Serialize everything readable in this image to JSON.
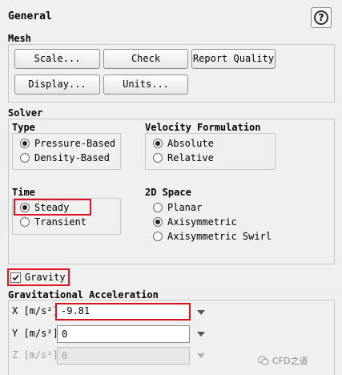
{
  "title": "General",
  "help_glyph": "?",
  "mesh": {
    "label": "Mesh",
    "buttons": {
      "scale": "Scale...",
      "check": "Check",
      "report_quality": "Report Quality",
      "display": "Display...",
      "units": "Units..."
    }
  },
  "solver": {
    "label": "Solver",
    "type": {
      "label": "Type",
      "options": [
        "Pressure-Based",
        "Density-Based"
      ],
      "selected": "Pressure-Based"
    },
    "velocity": {
      "label": "Velocity Formulation",
      "options": [
        "Absolute",
        "Relative"
      ],
      "selected": "Absolute"
    },
    "time": {
      "label": "Time",
      "options": [
        "Steady",
        "Transient"
      ],
      "selected": "Steady"
    },
    "space": {
      "label": "2D Space",
      "options": [
        "Planar",
        "Axisymmetric",
        "Axisymmetric Swirl"
      ],
      "selected": "Axisymmetric"
    }
  },
  "gravity": {
    "label": "Gravity",
    "checked": true,
    "acceleration_label": "Gravitational Acceleration",
    "x": {
      "label": "X [m/s²]",
      "value": "-9.81"
    },
    "y": {
      "label": "Y [m/s²]",
      "value": "0"
    },
    "z": {
      "label": "Z [m/s²]",
      "value": "0",
      "disabled": true
    }
  },
  "watermark": "CFD之道",
  "colors": {
    "highlight": "#e0141e",
    "panel_border": "#c8c8c8"
  }
}
